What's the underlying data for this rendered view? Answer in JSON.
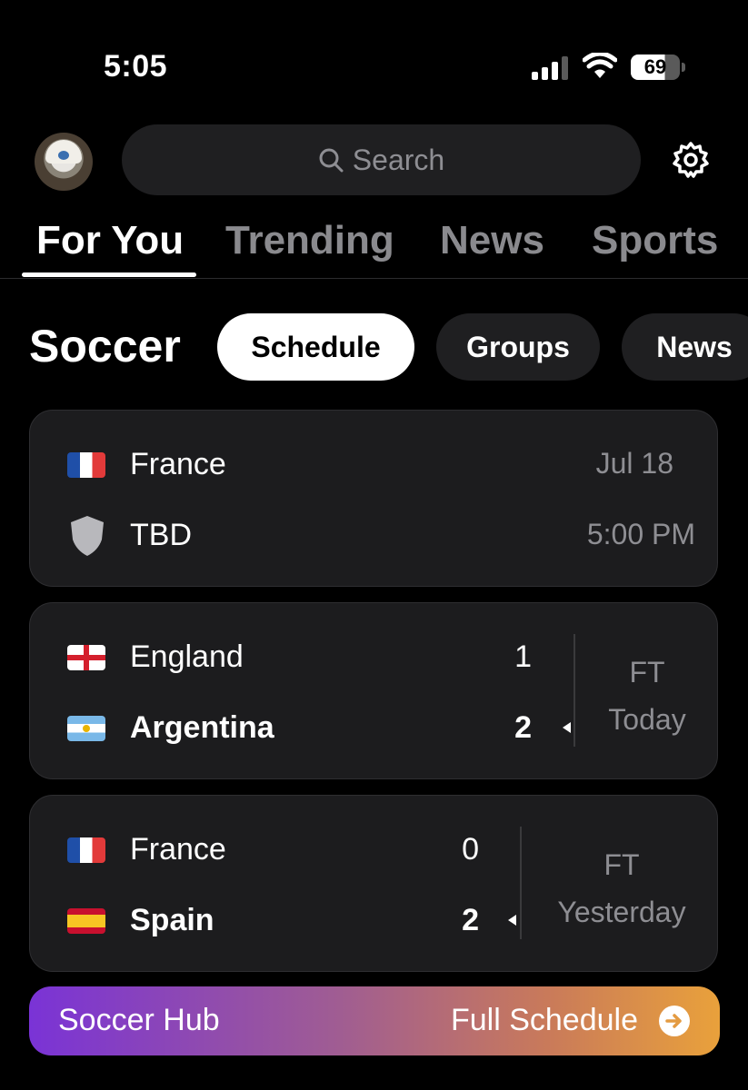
{
  "status_bar": {
    "time": "5:05",
    "battery": "69"
  },
  "search": {
    "placeholder": "Search"
  },
  "tabs": [
    {
      "label": "For You",
      "active": true
    },
    {
      "label": "Trending",
      "active": false
    },
    {
      "label": "News",
      "active": false
    },
    {
      "label": "Sports",
      "active": false
    }
  ],
  "section": {
    "title": "Soccer",
    "pills": [
      {
        "label": "Schedule",
        "active": true
      },
      {
        "label": "Groups",
        "active": false
      },
      {
        "label": "News",
        "active": false
      }
    ]
  },
  "matches": [
    {
      "team1": {
        "name": "France",
        "flag": "france-flag-icon"
      },
      "team2": {
        "name": "TBD",
        "flag": "shield-icon"
      },
      "date": "Jul 18",
      "time": "5:00 PM"
    },
    {
      "team1": {
        "name": "England",
        "score": "1",
        "flag": "england-flag-icon"
      },
      "team2": {
        "name": "Argentina",
        "score": "2",
        "flag": "argentina-flag-icon"
      },
      "status": "FT",
      "day": "Today"
    },
    {
      "team1": {
        "name": "France",
        "score": "0",
        "flag": "france-flag-icon"
      },
      "team2": {
        "name": "Spain",
        "score": "2",
        "flag": "spain-flag-icon"
      },
      "status": "FT",
      "day": "Yesterday"
    }
  ],
  "hub": {
    "left_label": "Soccer Hub",
    "right_label": "Full Schedule"
  },
  "colors": {
    "background": "#000000",
    "card": "#1c1c1e",
    "hub_start": "#7a33d6",
    "hub_end": "#e9a13b"
  }
}
